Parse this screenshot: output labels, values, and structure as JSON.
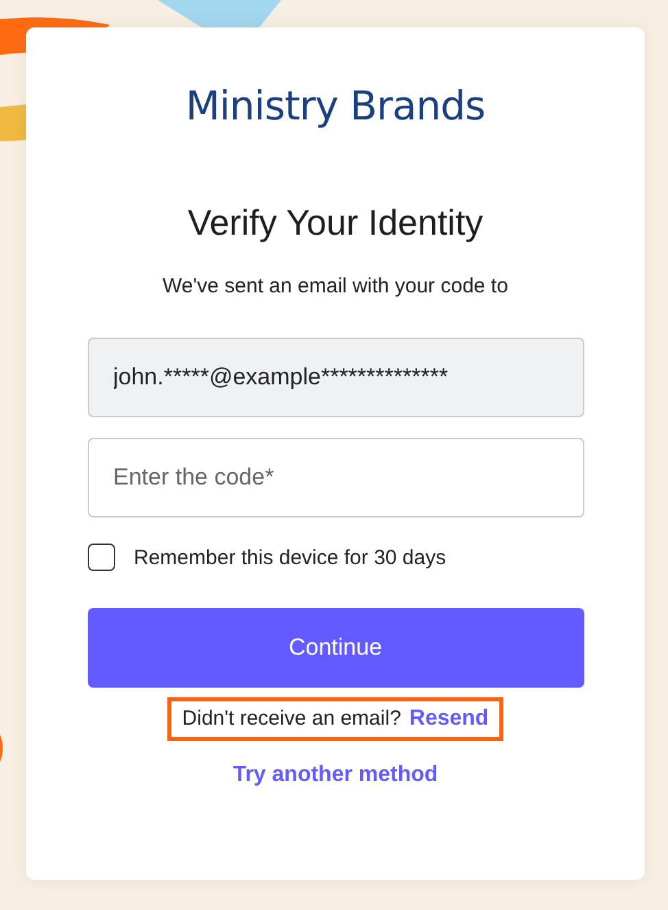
{
  "brand": {
    "logo": "Ministry Brands"
  },
  "title": "Verify Your Identity",
  "subtitle": "We've sent an email with your code to",
  "email_field": {
    "value": "john.*****@example**************"
  },
  "code_field": {
    "placeholder": "Enter the code*"
  },
  "remember": {
    "label": "Remember this device for 30 days",
    "checked": false
  },
  "continue_button": "Continue",
  "resend_prompt": {
    "text": "Didn't receive an email?",
    "link": "Resend",
    "highlighted": true
  },
  "other_method_link": "Try another method"
}
